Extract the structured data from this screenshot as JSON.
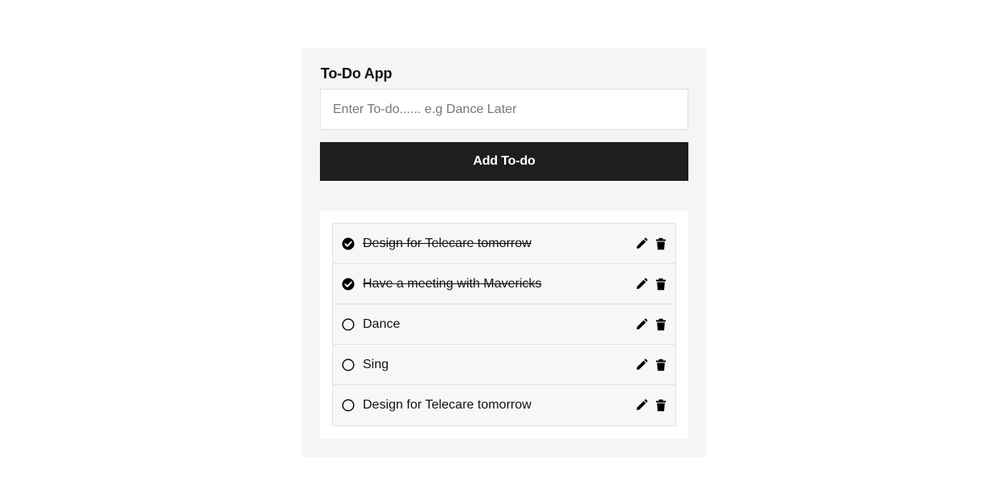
{
  "app": {
    "title": "To-Do App"
  },
  "form": {
    "input_value": "",
    "input_placeholder": "Enter To-do...... e.g Dance Later",
    "add_button_label": "Add To-do"
  },
  "todos": [
    {
      "text": "Design for Telecare tomorrow",
      "completed": true
    },
    {
      "text": "Have a meeting with Mavericks",
      "completed": true
    },
    {
      "text": "Dance",
      "completed": false
    },
    {
      "text": "Sing",
      "completed": false
    },
    {
      "text": "Design for Telecare tomorrow",
      "completed": false
    }
  ],
  "icons": {
    "completed": "check-circle-icon",
    "pending": "empty-circle-icon",
    "edit": "pencil-icon",
    "delete": "trash-icon"
  },
  "colors": {
    "page_background": "#ffffff",
    "panel_background": "#f5f5f5",
    "button_background": "#1e1e1e",
    "button_text": "#ffffff",
    "item_background": "#f7f7f7"
  }
}
